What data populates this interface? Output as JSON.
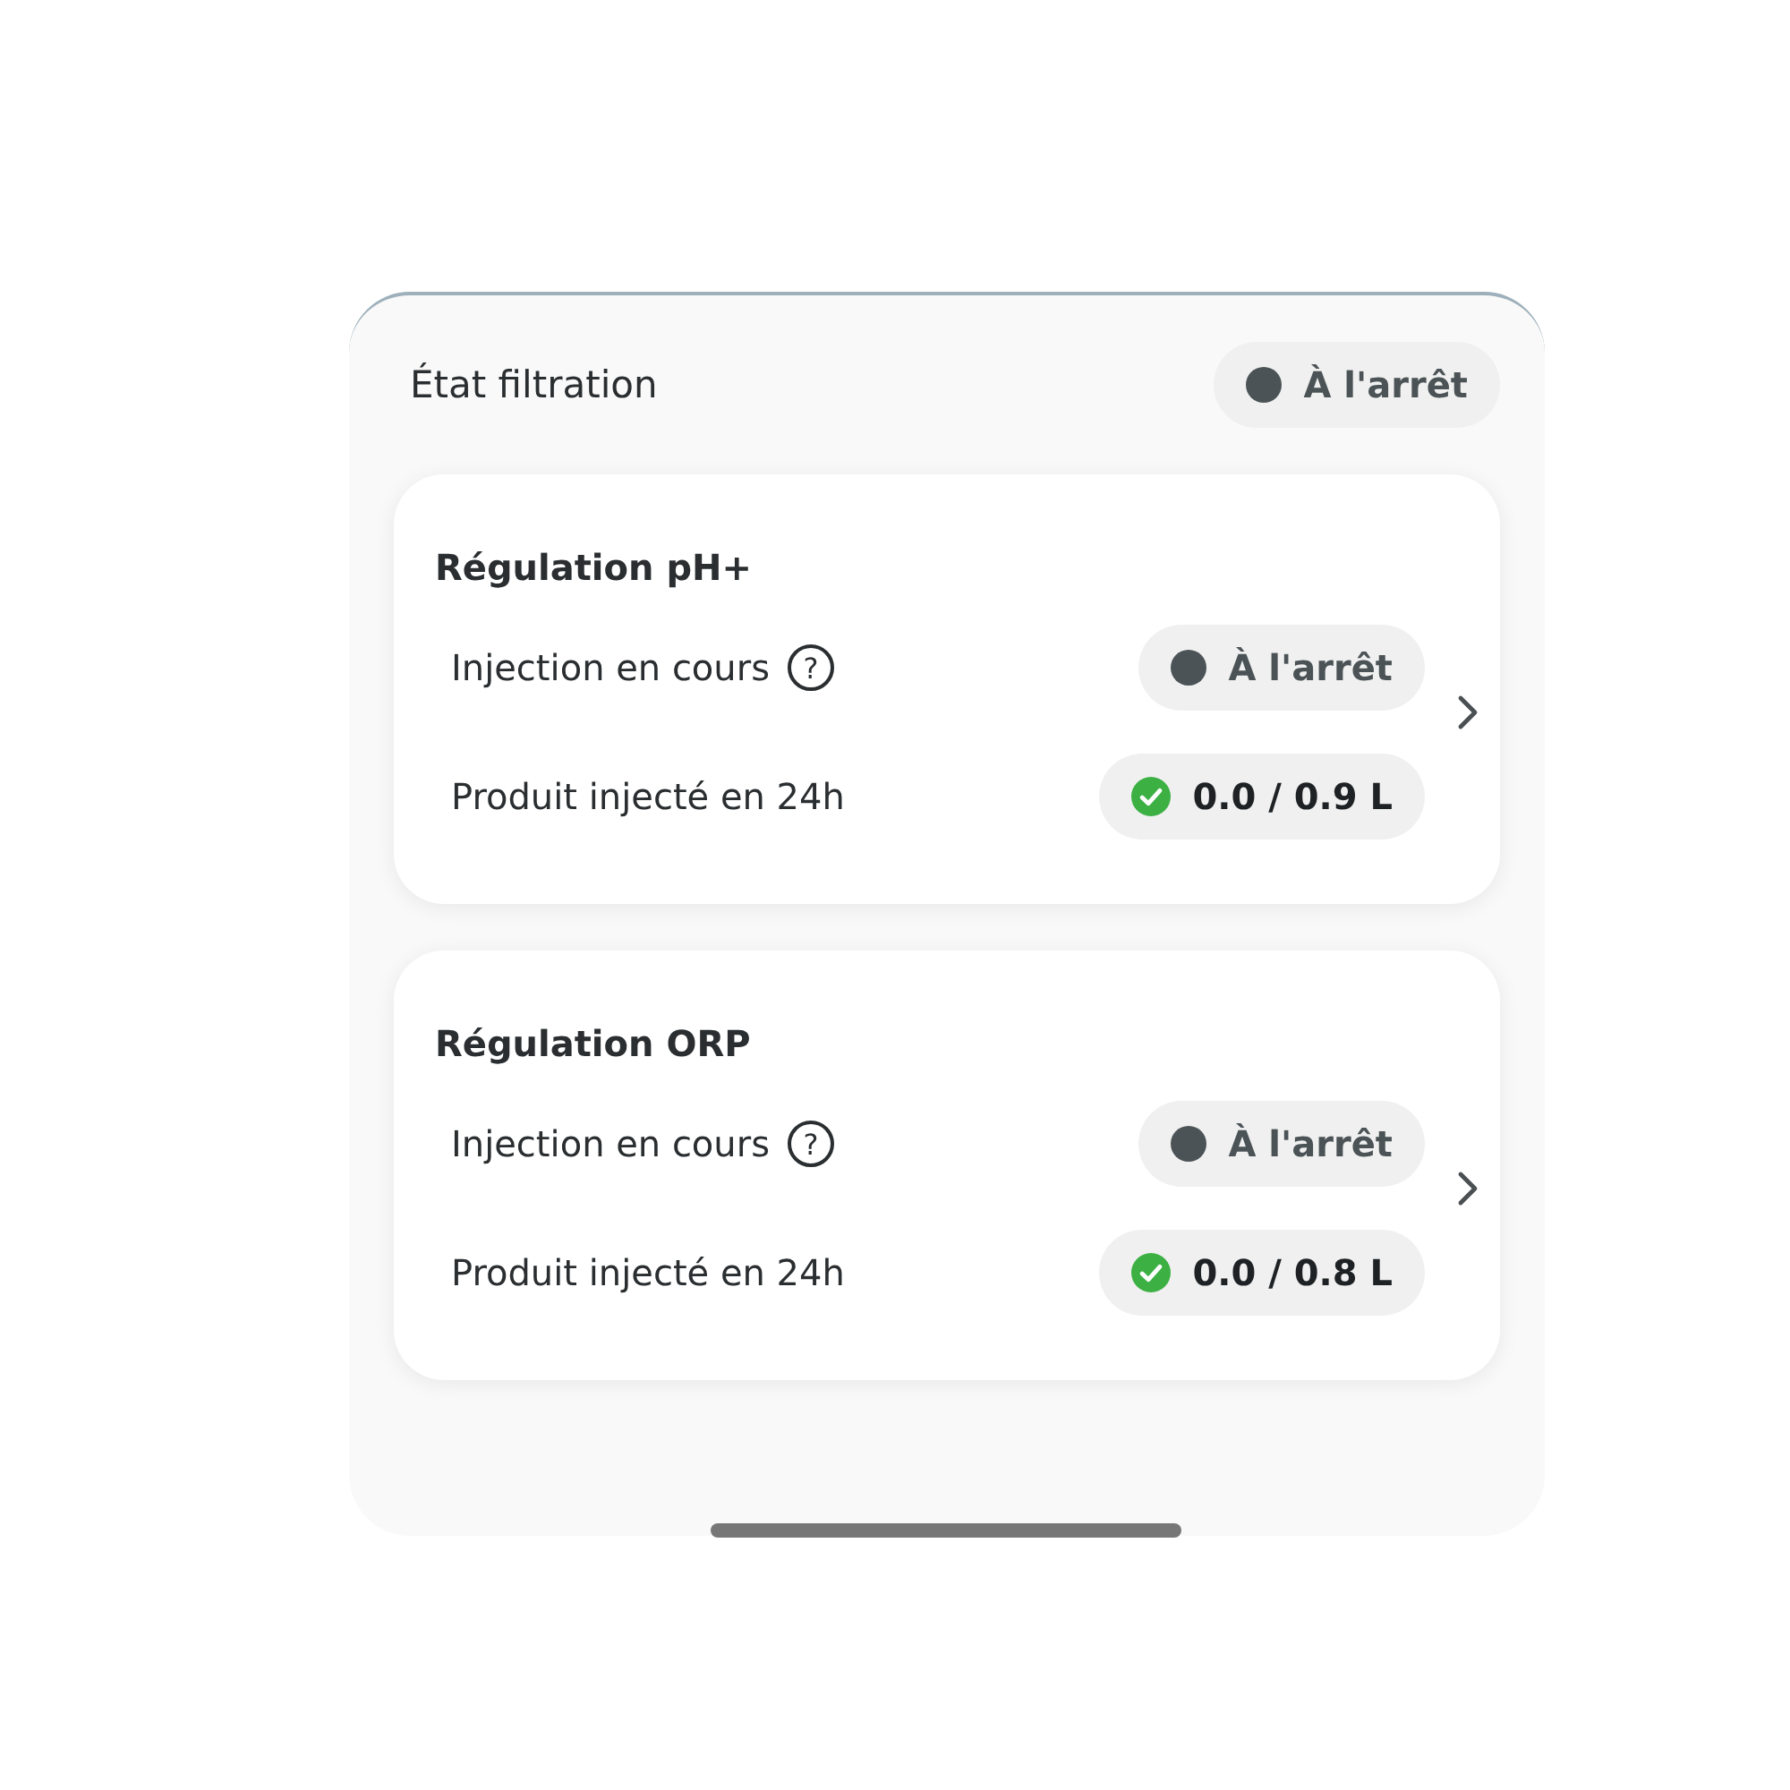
{
  "filtration": {
    "label": "État filtration",
    "status": {
      "text": "À l'arrêt",
      "running": false
    }
  },
  "regulations": [
    {
      "title": "Régulation pH+",
      "injection": {
        "label": "Injection en cours",
        "help": "?",
        "status": {
          "text": "À l'arrêt",
          "running": false
        }
      },
      "product": {
        "label": "Produit injecté en 24h",
        "value": "0.0 / 0.9 L",
        "ok": true
      }
    },
    {
      "title": "Régulation ORP",
      "injection": {
        "label": "Injection en cours",
        "help": "?",
        "status": {
          "text": "À l'arrêt",
          "running": false
        }
      },
      "product": {
        "label": "Produit injecté en 24h",
        "value": "0.0 / 0.8 L",
        "ok": true
      }
    }
  ]
}
